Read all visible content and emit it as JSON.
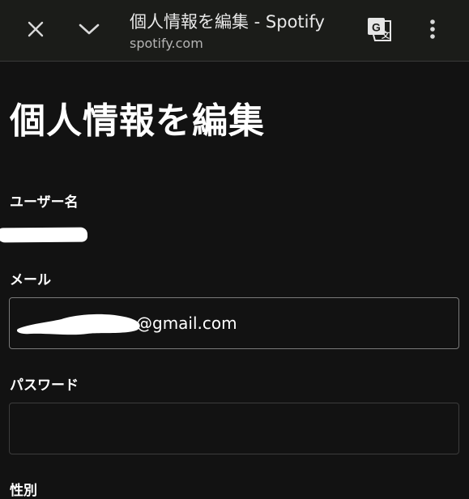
{
  "browser": {
    "tab_title": "個人情報を編集 - Spotify",
    "url": "spotify.com",
    "icons": {
      "close": "close-icon",
      "collapse": "chevron-down-icon",
      "translate": "translate-icon",
      "menu": "more-vert-icon"
    }
  },
  "page": {
    "title": "個人情報を編集",
    "fields": {
      "username_label": "ユーザー名",
      "email_label": "メール",
      "email_value_visible": "@gmail.com",
      "password_label": "パスワード",
      "password_value": "",
      "gender_label": "性別"
    }
  },
  "colors": {
    "background": "#121212",
    "topbar": "#1b1c19",
    "text": "#ffffff",
    "input_border": "#7a7a7a"
  }
}
